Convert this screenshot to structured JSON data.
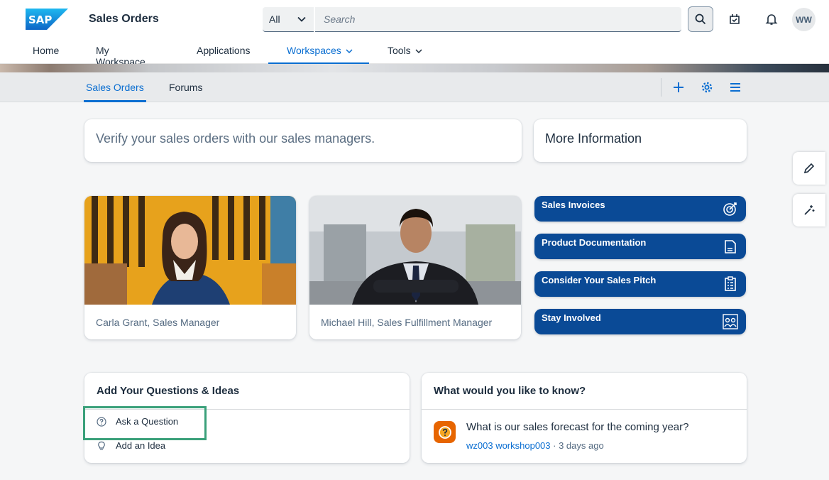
{
  "header": {
    "app_title": "Sales Orders",
    "scope_value": "All",
    "search_placeholder": "Search",
    "avatar_initials": "WW",
    "brand_color": "#0a6ed1"
  },
  "topnav": [
    {
      "label": "Home"
    },
    {
      "label": "My Workspace"
    },
    {
      "label": "Applications"
    },
    {
      "label": "Workspaces"
    },
    {
      "label": "Tools"
    }
  ],
  "workspace_tabs": [
    {
      "label": "Sales Orders"
    },
    {
      "label": "Forums"
    }
  ],
  "intro": {
    "text": "Verify your sales orders with our sales managers."
  },
  "more_info": {
    "title": "More Information"
  },
  "people": [
    {
      "caption": "Carla Grant, Sales Manager"
    },
    {
      "caption": "Michael Hill, Sales Fulfillment Manager"
    }
  ],
  "links": [
    {
      "label": "Sales Invoices",
      "icon": "target-icon"
    },
    {
      "label": "Product Documentation",
      "icon": "document-icon"
    },
    {
      "label": "Consider Your Sales Pitch",
      "icon": "checklist-icon"
    },
    {
      "label": "Stay Involved",
      "icon": "people-map-icon"
    }
  ],
  "questions": {
    "title": "Add Your Questions & Ideas",
    "items": [
      {
        "label": "Ask a Question",
        "icon": "question-icon"
      },
      {
        "label": "Add an Idea",
        "icon": "lightbulb-icon"
      }
    ]
  },
  "feed": {
    "title": "What would you like to know?",
    "question": "What is our sales forecast for the coming year?",
    "author": "wz003 workshop003",
    "time": " · 3 days ago"
  }
}
